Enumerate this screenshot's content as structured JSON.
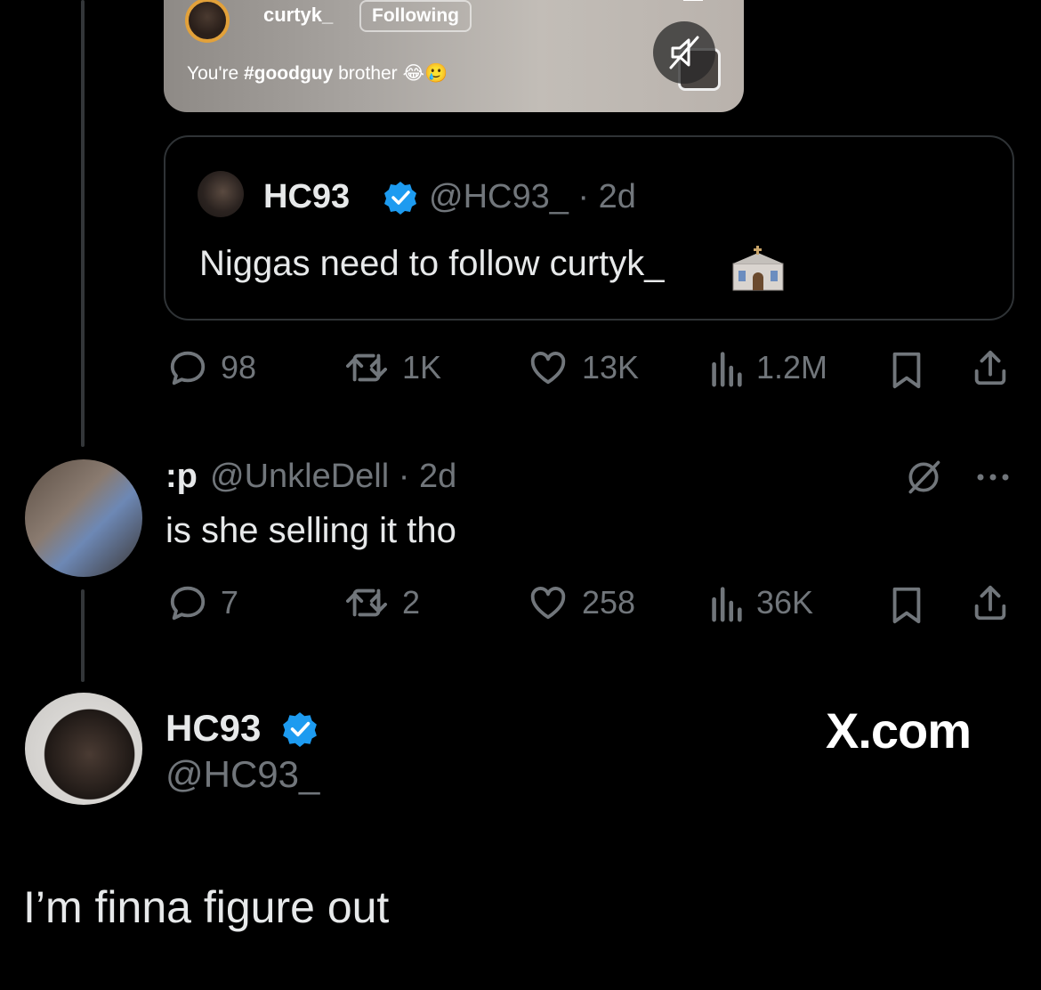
{
  "video": {
    "username": "curtyk_",
    "follow_label": "Following",
    "caption_prefix": "You're ",
    "caption_hashtag": "#goodguy",
    "caption_suffix": " brother"
  },
  "quoted": {
    "name": "HC93",
    "handle_time": "@HC93_ · 2d",
    "text": "Niggas need to follow curtyk_"
  },
  "quoted_actions": {
    "replies": "98",
    "reposts": "1K",
    "likes": "13K",
    "views": "1.2M"
  },
  "reply": {
    "name": ":p",
    "handle_time": "@UnkleDell · 2d",
    "text": "is she selling it tho",
    "actions": {
      "replies": "7",
      "reposts": "2",
      "likes": "258",
      "views": "36K"
    }
  },
  "author": {
    "name": "HC93",
    "handle": "@HC93_"
  },
  "brand": "X.com",
  "main_text": "I’m finna figure out",
  "colors": {
    "background": "#000000",
    "text": "#e7e9ea",
    "muted": "#71767b",
    "verified": "#1d9bf0",
    "border": "#2f3336"
  }
}
